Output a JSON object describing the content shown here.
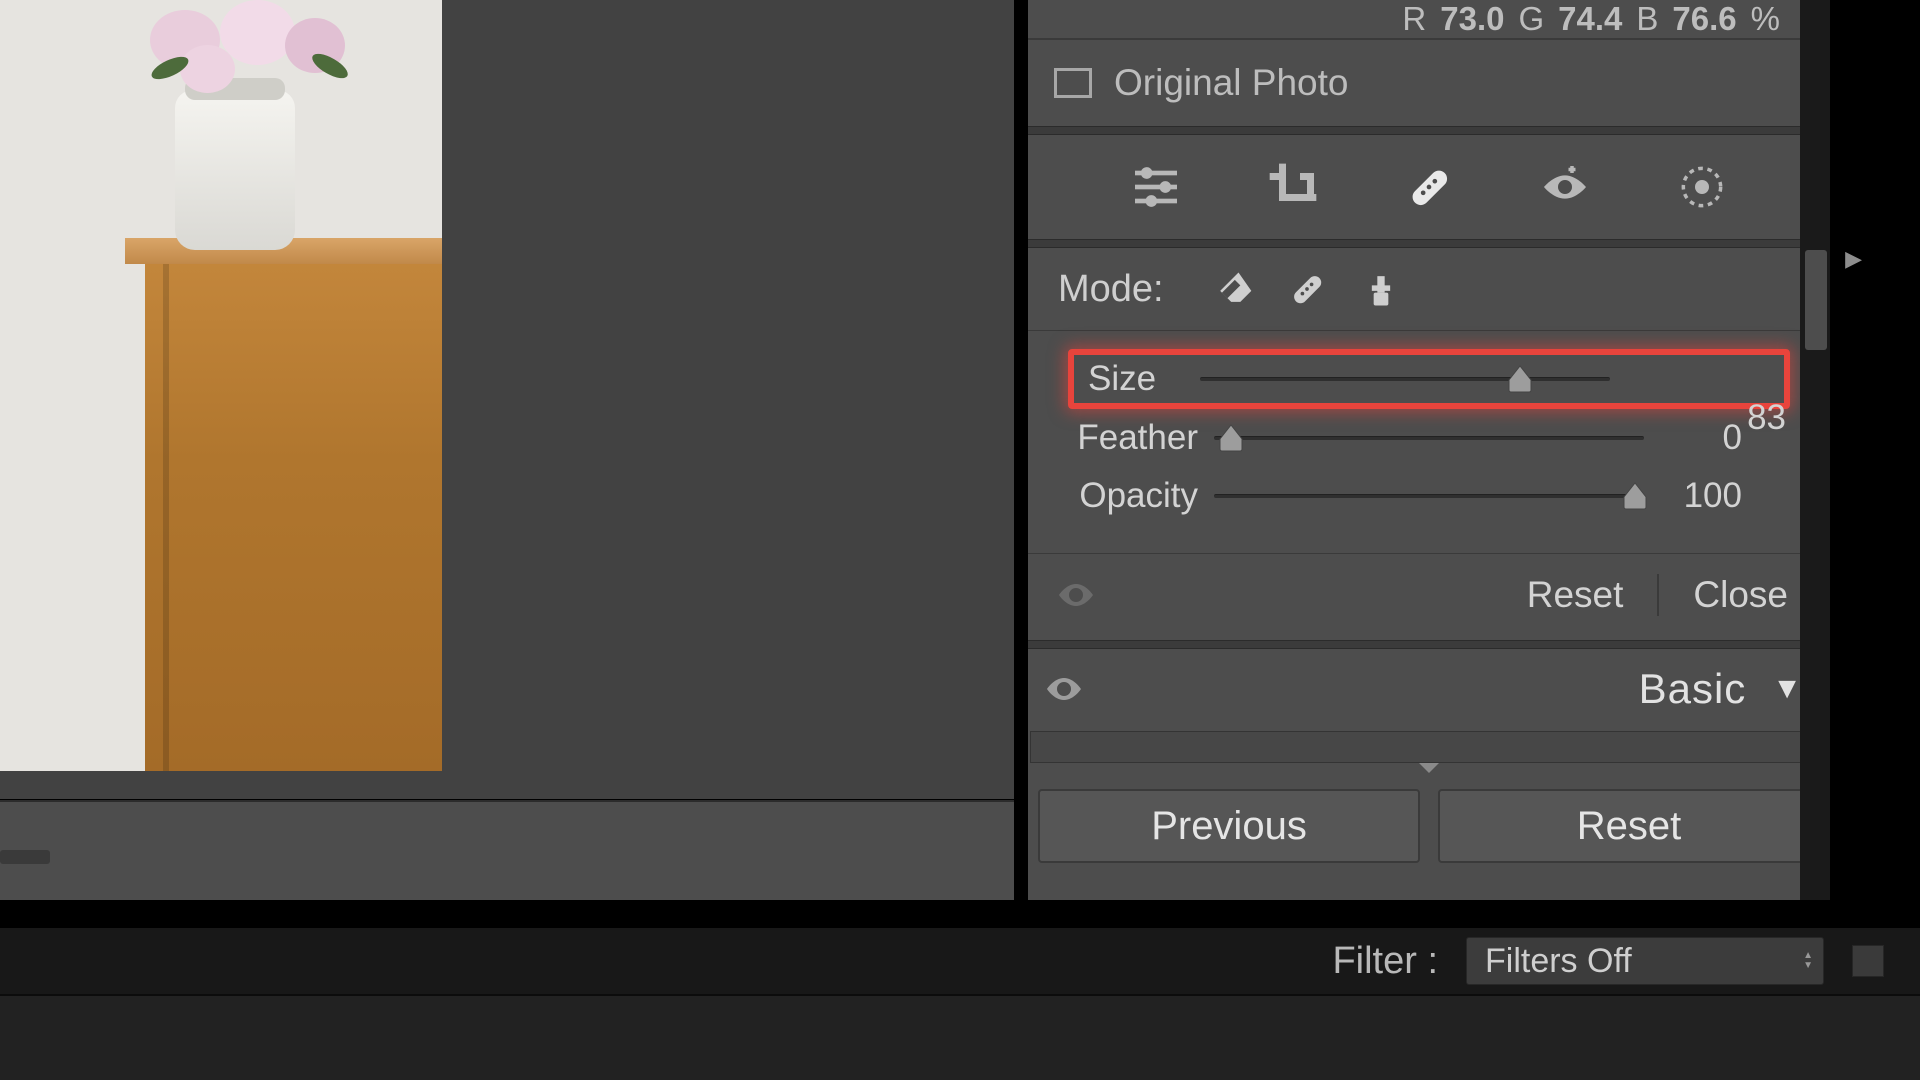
{
  "rgb": {
    "r_label": "R",
    "r": "73.0",
    "g_label": "G",
    "g": "74.4",
    "b_label": "B",
    "b": "76.6",
    "pct": "%"
  },
  "original": {
    "label": "Original Photo",
    "checked": false
  },
  "tools": [
    "sliders-icon",
    "crop-icon",
    "heal-icon",
    "redeye-icon",
    "radial-icon"
  ],
  "mode": {
    "label": "Mode:",
    "options": [
      "eraser-icon",
      "heal-icon",
      "clone-icon"
    ]
  },
  "sliders": {
    "size": {
      "label": "Size",
      "value": "83",
      "pct": 78
    },
    "feather": {
      "label": "Feather",
      "value": "0",
      "pct": 4
    },
    "opacity": {
      "label": "Opacity",
      "value": "100",
      "pct": 98
    }
  },
  "actions": {
    "reset": "Reset",
    "close": "Close"
  },
  "basic": {
    "label": "Basic"
  },
  "nav": {
    "previous": "Previous",
    "reset": "Reset"
  },
  "filter": {
    "label": "Filter :",
    "value": "Filters Off"
  },
  "highlight": {
    "target": "size",
    "color": "#e8443c"
  }
}
